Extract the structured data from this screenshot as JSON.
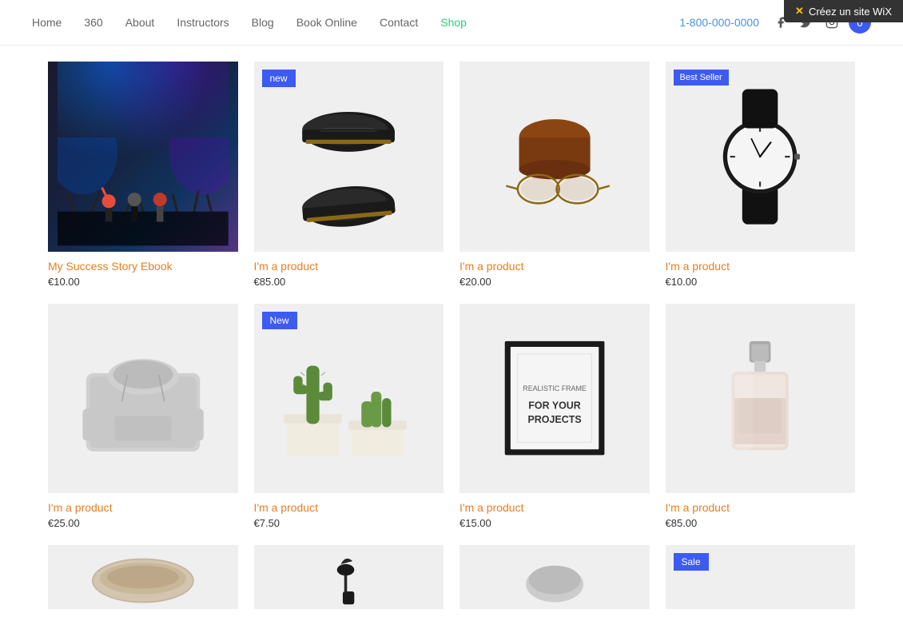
{
  "wix_banner": {
    "icon": "✕",
    "text": "Créez un site WiX"
  },
  "nav": {
    "links": [
      {
        "label": "Home",
        "active": false,
        "class": ""
      },
      {
        "label": "360",
        "active": false,
        "class": ""
      },
      {
        "label": "About",
        "active": false,
        "class": ""
      },
      {
        "label": "Instructors",
        "active": false,
        "class": ""
      },
      {
        "label": "Blog",
        "active": false,
        "class": ""
      },
      {
        "label": "Book Online",
        "active": false,
        "class": ""
      },
      {
        "label": "Contact",
        "active": false,
        "class": ""
      },
      {
        "label": "Shop",
        "active": false,
        "class": "shop"
      }
    ],
    "phone": "1-800-000-0000",
    "cart_count": "0"
  },
  "products_row1": [
    {
      "id": "p1",
      "title": "My Success Story Ebook",
      "price": "€10.00",
      "badge": null,
      "type": "concert"
    },
    {
      "id": "p2",
      "title": "I'm a product",
      "price": "€85.00",
      "badge": "new",
      "type": "shoes"
    },
    {
      "id": "p3",
      "title": "I'm a product",
      "price": "€20.00",
      "badge": null,
      "type": "glasses"
    },
    {
      "id": "p4",
      "title": "I'm a product",
      "price": "€10.00",
      "badge": "Best Seller",
      "type": "watch"
    }
  ],
  "products_row2": [
    {
      "id": "p5",
      "title": "I'm a product",
      "price": "€25.00",
      "badge": null,
      "type": "hoodie"
    },
    {
      "id": "p6",
      "title": "I'm a product",
      "price": "€7.50",
      "badge": "New",
      "type": "cactus"
    },
    {
      "id": "p7",
      "title": "I'm a product",
      "price": "€15.00",
      "badge": null,
      "type": "frame"
    },
    {
      "id": "p8",
      "title": "I'm a product",
      "price": "€85.00",
      "badge": null,
      "type": "perfume"
    }
  ],
  "products_row3": [
    {
      "id": "p9",
      "title": "",
      "price": "",
      "badge": null,
      "type": "bottom1"
    },
    {
      "id": "p10",
      "title": "",
      "price": "",
      "badge": null,
      "type": "bottom2"
    },
    {
      "id": "p11",
      "title": "",
      "price": "",
      "badge": null,
      "type": "bottom3"
    },
    {
      "id": "p12",
      "title": "",
      "price": "",
      "badge": "Sale",
      "type": "bottom4"
    }
  ]
}
